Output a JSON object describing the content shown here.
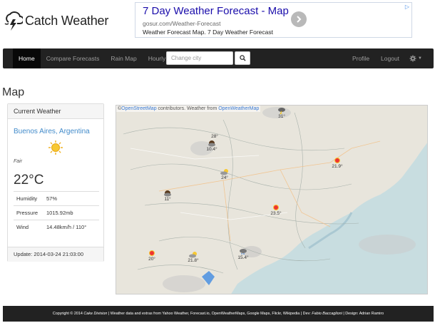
{
  "brand": {
    "name": "Catch Weather",
    "icon": "cloud-lightning-icon"
  },
  "ad": {
    "title": "7 Day Weather Forecast - Map",
    "url": "gosur.com/Weather-Forecast",
    "description": "Weather Forecast Map. 7 Day Weather Forecast",
    "arrow_icon": "chevron-right-icon",
    "corner_icon": "adchoices-icon"
  },
  "nav": {
    "items": [
      {
        "label": "Home",
        "active": true
      },
      {
        "label": "Compare Forecasts",
        "active": false
      },
      {
        "label": "Rain Map",
        "active": false
      },
      {
        "label": "Hourly",
        "active": false
      }
    ],
    "search_placeholder": "Change city",
    "search_icon": "search-icon",
    "profile": "Profile",
    "logout": "Logout",
    "settings_icon": "gear-icon"
  },
  "page": {
    "title": "Map"
  },
  "current": {
    "header": "Current Weather",
    "city": "Buenos Aires, Argentina",
    "icon": "sun-icon",
    "condition": "Fair",
    "temperature": "22°C",
    "rows": [
      {
        "label": "Humidity",
        "value": "57%"
      },
      {
        "label": "Pressure",
        "value": "1015.92mb"
      },
      {
        "label": "Wind",
        "value": "14.48km/h / 110°"
      }
    ],
    "update": "Update: 2014-03-24 21:03:00"
  },
  "map": {
    "attribution_prefix": "©",
    "attribution_link1": "OpenStreetMap",
    "attribution_mid": " contributors. Weather from ",
    "attribution_link2": "OpenWeatherMap",
    "markers": [
      {
        "temp": "31°",
        "icon": "storm-icon"
      },
      {
        "temp": "28°",
        "icon": ""
      },
      {
        "temp": "10.4°",
        "icon": "moon-cloud-icon"
      },
      {
        "temp": "24°",
        "icon": "sun-cloud-icon"
      },
      {
        "temp": "21.9°",
        "icon": "sun-icon"
      },
      {
        "temp": "11°",
        "icon": "moon-cloud-icon"
      },
      {
        "temp": "23.5°",
        "icon": "sun-icon"
      },
      {
        "temp": "20°",
        "icon": "sun-icon"
      },
      {
        "temp": "21.8°",
        "icon": "sun-cloud-icon"
      },
      {
        "temp": "15.4°",
        "icon": "rain-icon"
      }
    ]
  },
  "footer": {
    "prefix": "Copyright © 2014 ",
    "company": "Cake Division",
    "middle": " | Weather data and extras from Yahoo Weather, Forecast.io, OpenWeatherMaps, Google Maps, Flickr, Wikipedia | Dev: ",
    "dev": "Fabio Baccaglioni",
    "suffix": " | Design: Adrian Ramiro"
  },
  "colors": {
    "navbar": "#222222",
    "link": "#428bca",
    "ad_title": "#1a0dab"
  }
}
